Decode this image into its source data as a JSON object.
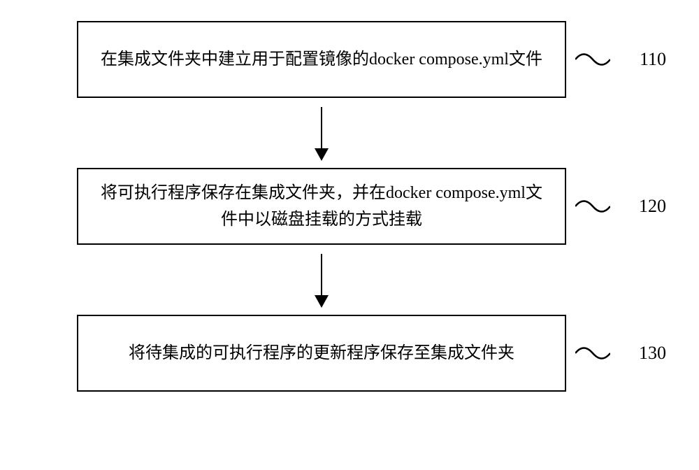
{
  "flowchart": {
    "steps": [
      {
        "text": "在集成文件夹中建立用于配置镜像的docker compose.yml文件",
        "label": "110"
      },
      {
        "text": "将可执行程序保存在集成文件夹，并在docker compose.yml文件中以磁盘挂载的方式挂载",
        "label": "120"
      },
      {
        "text": "将待集成的可执行程序的更新程序保存至集成文件夹",
        "label": "130"
      }
    ]
  }
}
